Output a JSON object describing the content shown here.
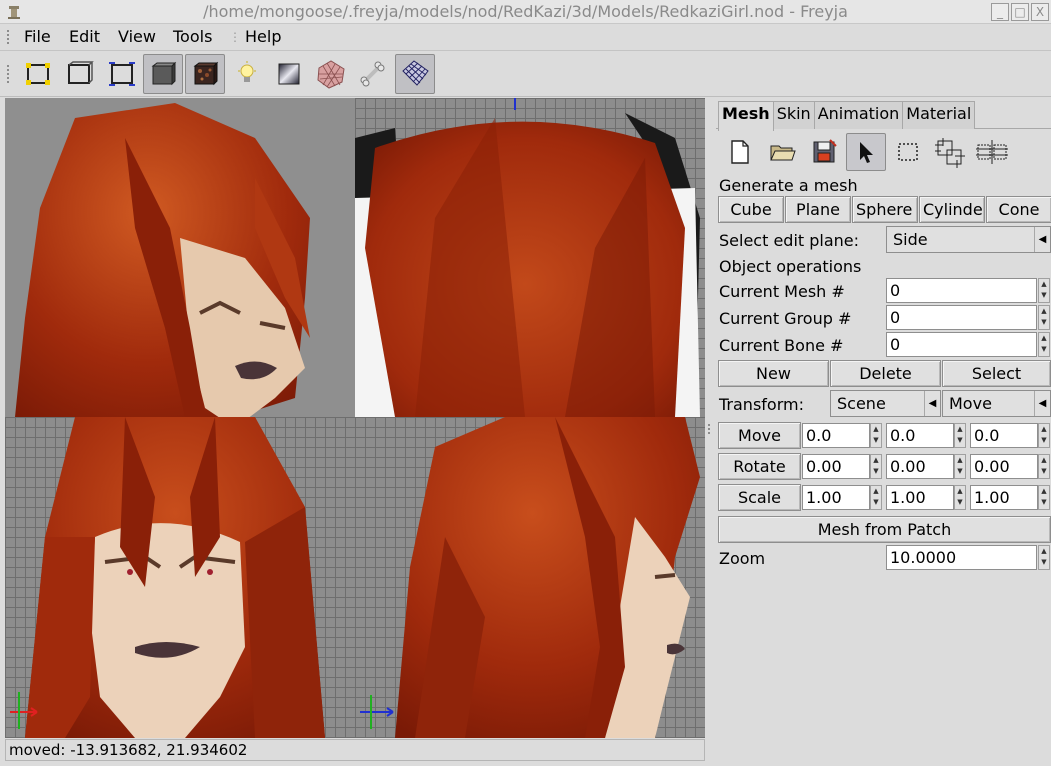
{
  "window": {
    "title": "/home/mongoose/.freyja/models/nod/RedKazi/3d/Models/RedkaziGirl.nod - Freyja",
    "controls": [
      "_",
      "□",
      "X"
    ]
  },
  "menu": [
    "File",
    "Edit",
    "View",
    "Tools",
    "Help"
  ],
  "toolbar": {
    "items": [
      {
        "icon": "select-vertex-frame-icon",
        "active": false
      },
      {
        "icon": "wireframe-frame-icon",
        "active": false
      },
      {
        "icon": "bounding-box-icon",
        "active": false
      },
      {
        "icon": "solid-box-icon",
        "active": true
      },
      {
        "icon": "textured-box-icon",
        "active": true
      },
      {
        "icon": "light-bulb-icon",
        "active": false
      },
      {
        "icon": "material-gradient-icon",
        "active": false
      },
      {
        "icon": "texture-mesh-icon",
        "active": false
      },
      {
        "icon": "bone-icon",
        "active": false
      },
      {
        "icon": "grid-icon",
        "active": true
      }
    ]
  },
  "status": "moved: -13.913682, 21.934602",
  "panel": {
    "tabs": [
      "Mesh",
      "Skin",
      "Animation",
      "Material"
    ],
    "active_tab": "Mesh",
    "tools": [
      "new-file-icon",
      "open-folder-icon",
      "save-icon",
      "pointer-icon",
      "select-rect-icon",
      "vertex-group-icon",
      "vertex-split-icon"
    ],
    "generate_label": "Generate a mesh",
    "generate_buttons": [
      "Cube",
      "Plane",
      "Sphere",
      "Cylinder",
      "Cone"
    ],
    "edit_plane_label": "Select edit plane:",
    "edit_plane_value": "Side",
    "object_ops_label": "Object operations",
    "current_mesh_label": "Current Mesh  #",
    "current_mesh_value": "0",
    "current_group_label": "Current Group #",
    "current_group_value": "0",
    "current_bone_label": "Current Bone #",
    "current_bone_value": "0",
    "new_label": "New",
    "delete_label": "Delete",
    "select_label": "Select",
    "transform_label": "Transform:",
    "transform_space": "Scene",
    "transform_action": "Move",
    "move_label": "Move",
    "move_values": [
      "0.0",
      "0.0",
      "0.0"
    ],
    "rotate_label": "Rotate",
    "rotate_values": [
      "0.00",
      "0.00",
      "0.00"
    ],
    "scale_label": "Scale",
    "scale_values": [
      "1.00",
      "1.00",
      "1.00"
    ],
    "mesh_from_patch_label": "Mesh from Patch",
    "zoom_label": "Zoom",
    "zoom_value": "10.0000"
  },
  "colors": {
    "hair": "#a8300f",
    "hair_dark": "#6e1a08",
    "skin": "#e8cdb3",
    "lips": "#4a3438",
    "viewport_gray": "#8d8d8d",
    "grid_line": "#6e6e6e"
  }
}
